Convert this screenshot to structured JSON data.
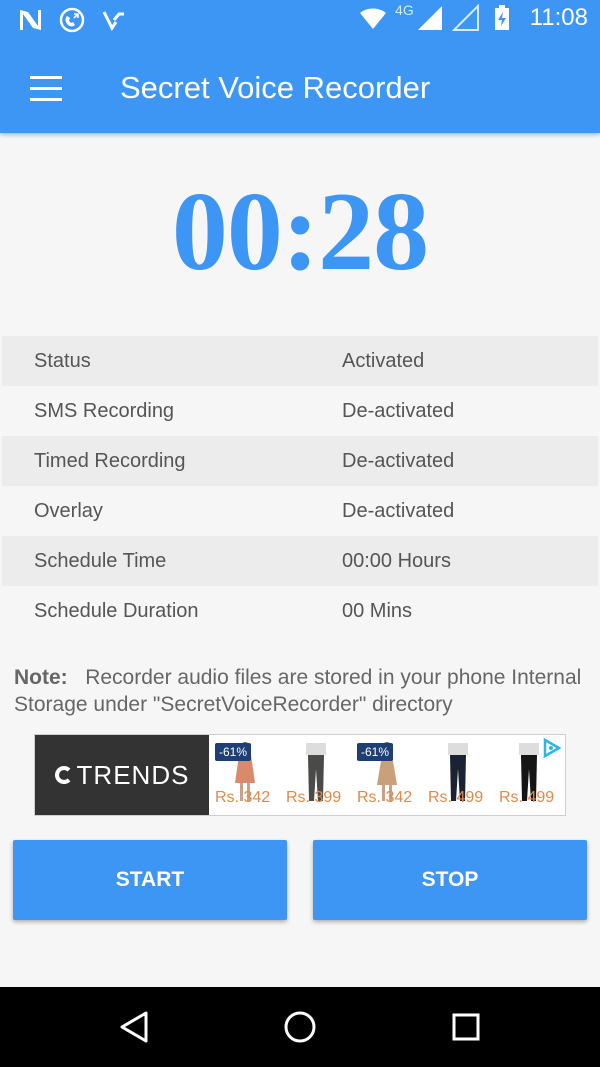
{
  "status_bar": {
    "time": "11:08",
    "network": "4G",
    "icons": [
      "n-icon",
      "phone-forward-icon",
      "check-tray-icon",
      "wifi-icon",
      "signal-icon",
      "signal-empty-icon",
      "battery-charging-icon"
    ]
  },
  "toolbar": {
    "title": "Secret Voice Recorder",
    "menu_icon": "hamburger-menu-icon"
  },
  "timer": "00:28",
  "info_rows": [
    {
      "key": "Status",
      "value": "Activated"
    },
    {
      "key": "SMS Recording",
      "value": "De-activated"
    },
    {
      "key": "Timed Recording",
      "value": "De-activated"
    },
    {
      "key": "Overlay",
      "value": "De-activated"
    },
    {
      "key": "Schedule Time",
      "value": "00:00 Hours"
    },
    {
      "key": "Schedule Duration",
      "value": "00 Mins"
    }
  ],
  "note": {
    "label": "Note:",
    "text": "Recorder audio files are stored in your phone Internal Storage under \"SecretVoiceRecorder\" directory"
  },
  "ad": {
    "brand": "TRENDS",
    "products": [
      {
        "badge": "-61%",
        "price": "Rs. 342"
      },
      {
        "badge": "",
        "price": "Rs. 399"
      },
      {
        "badge": "-61%",
        "price": "Rs. 342"
      },
      {
        "badge": "",
        "price": "Rs. 499"
      },
      {
        "badge": "",
        "price": "Rs. 499"
      }
    ]
  },
  "buttons": {
    "start": "START",
    "stop": "STOP"
  },
  "nav": [
    "back-icon",
    "home-icon",
    "recents-icon"
  ],
  "colors": {
    "accent": "#3d96f4",
    "text": "#555555",
    "price": "#e08a4c"
  }
}
